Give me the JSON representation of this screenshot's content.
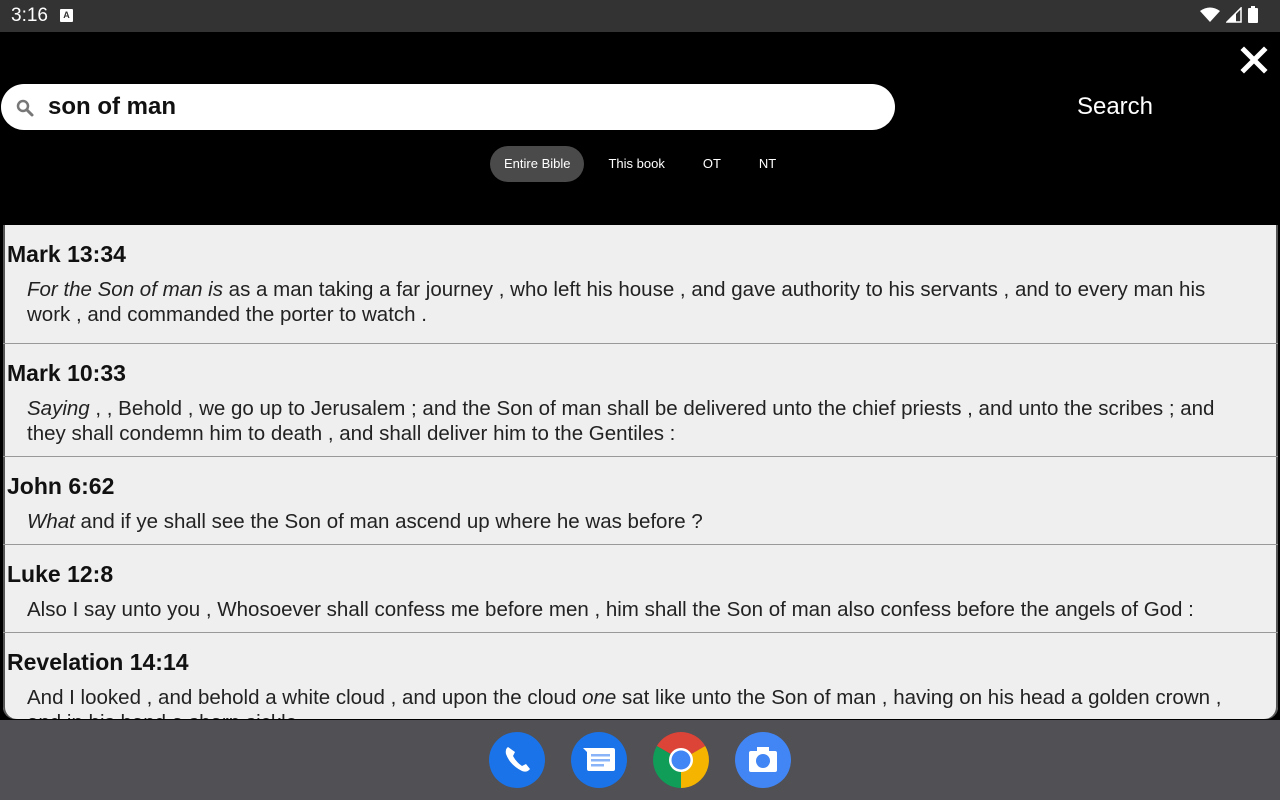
{
  "status_bar": {
    "time": "3:16",
    "notification_icon": "A",
    "icons": [
      "wifi-icon",
      "cellular-signal-icon",
      "battery-icon"
    ]
  },
  "search": {
    "query": "son of man",
    "placeholder": "",
    "button_label": "Search",
    "close_icon": "close-icon"
  },
  "filters": [
    {
      "label": "Entire Bible",
      "active": true
    },
    {
      "label": "This book",
      "active": false
    },
    {
      "label": "OT",
      "active": false
    },
    {
      "label": "NT",
      "active": false
    }
  ],
  "results": [
    {
      "reference": "Mark 13:34",
      "italic": "For the Son of man is",
      "text": " as a man taking a far journey , who left his house , and gave authority to his servants , and to every man his work , and commanded the porter to watch ."
    },
    {
      "reference": "Mark 10:33",
      "italic": "Saying",
      "text": " , , Behold , we go up to Jerusalem ; and the Son of man shall be delivered unto the chief priests , and unto the scribes ; and they shall condemn him to death , and shall deliver him to the Gentiles :"
    },
    {
      "reference": "John 6:62",
      "italic": "What",
      "text": " and if ye shall see the Son of man ascend up where he was before ?"
    },
    {
      "reference": "Luke 12:8",
      "italic": "",
      "text": "Also I say unto you , Whosoever shall confess me before men , him shall the Son of man also confess before the angels of God :"
    },
    {
      "reference": "Revelation 14:14",
      "pre": "And I looked , and behold a white cloud , and upon the cloud ",
      "italic": "one",
      "text": " sat like unto the Son of man , having on his head a golden crown , and in his hand a sharp sickle."
    }
  ],
  "dock": [
    {
      "name": "phone-app-icon",
      "color": "#1a73e8"
    },
    {
      "name": "messages-app-icon",
      "color": "#1a73e8"
    },
    {
      "name": "chrome-app-icon",
      "color": "#ffffff"
    },
    {
      "name": "camera-app-icon",
      "color": "#4285f4"
    }
  ]
}
